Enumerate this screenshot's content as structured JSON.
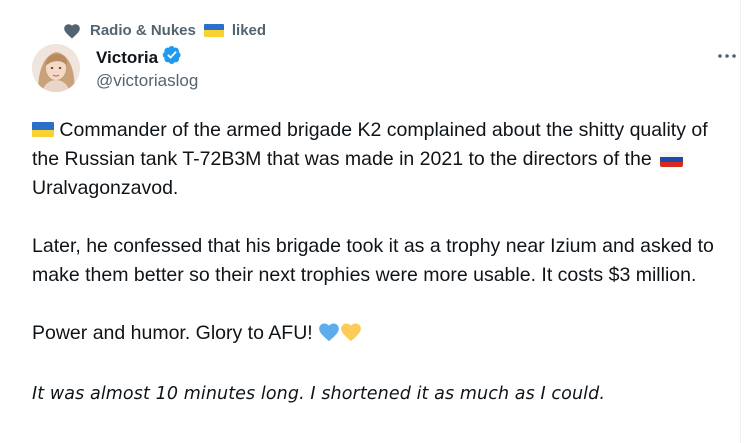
{
  "social_context": {
    "user": "Radio & Nukes",
    "flag": "ukraine-flag",
    "action": "liked"
  },
  "author": {
    "name": "Victoria",
    "verified": true,
    "handle": "@victoriaslog"
  },
  "tweet": {
    "p1_a": " Commander of the armed brigade K2 complained about the shitty quality of the Russian tank T-72B3M that was made in 2021 to the directors of the ",
    "p1_b": " Uralvagonzavod.",
    "p2": "Later, he confessed that his brigade took it as a trophy near Izium and asked to make them better so their next trophies were more usable. It costs $3 million.",
    "p3": "Power and humor. Glory to AFU! ",
    "p4": "It was almost 10 minutes long. I shortened it as much as I could."
  },
  "icons": {
    "heart": "heart-icon",
    "verified": "verified-badge-icon",
    "more": "more-options-icon"
  },
  "colors": {
    "verified_blue": "#1d9bf0",
    "secondary_text": "#536471",
    "heart_blue": "#5dadec",
    "heart_yellow": "#fdcb58"
  }
}
